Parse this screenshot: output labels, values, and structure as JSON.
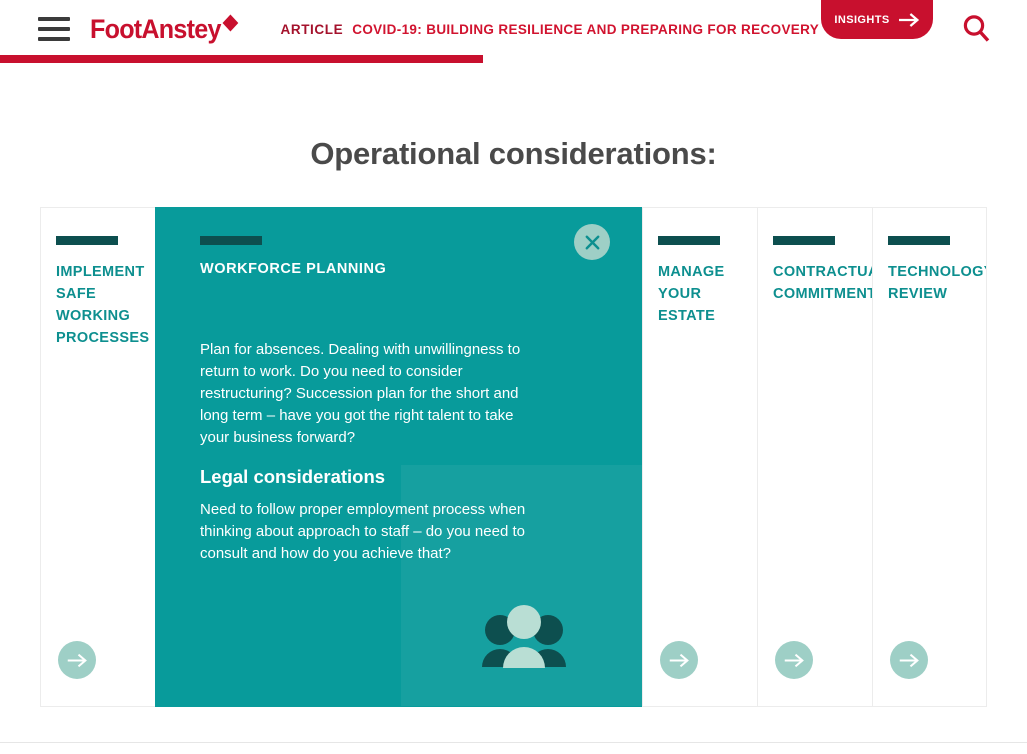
{
  "header": {
    "menu_icon": "hamburger-icon",
    "brand": "FootAnstey",
    "article_kicker": "ARTICLE",
    "article_title": "COVID-19: BUILDING RESILIENCE AND PREPARING FOR RECOVERY",
    "insights_label": "INSIGHTS",
    "insights_icon": "arrow-right-icon",
    "search_icon": "search-icon",
    "brand_color": "#c8102e",
    "progress_percent": 47
  },
  "main": {
    "page_title": "Operational considerations:",
    "accent_color": "#089b9b",
    "rule_color": "#0d4f4f",
    "title_color": "#0d8f8f",
    "arrow_circle_color": "#9ecfc6",
    "cards": [
      {
        "id": "implement-safe-working-processes",
        "title": "IMPLEMENT\nSAFE\nWORKING\nPROCESSES",
        "title_lines": [
          "IMPLEMENT",
          "SAFE",
          "WORKING",
          "PROCESSES"
        ],
        "expanded": false,
        "arrow_icon": "arrow-right-icon"
      },
      {
        "id": "workforce-planning",
        "title": "WORKFORCE PLANNING",
        "expanded": true,
        "close_icon": "close-icon",
        "icon": "people-group-icon",
        "paragraph": "Plan for absences. Dealing with unwillingness to return to work. Do you need to consider restructuring? Succession plan for the short and long term – have you got the right talent to take your business forward?",
        "subheading": "Legal considerations",
        "legal_paragraph": "Need to follow proper employment process when thinking about approach to staff – do you need to consult and how do you achieve that?"
      },
      {
        "id": "manage-your-estate",
        "title": "MANAGE\nYOUR\nESTATE",
        "title_lines": [
          "MANAGE",
          "YOUR",
          "ESTATE"
        ],
        "expanded": false,
        "arrow_icon": "arrow-right-icon"
      },
      {
        "id": "contractual-commitments",
        "title": "CONTRACTUAL\nCOMMITMENTS",
        "title_lines": [
          "CONTRACTUAL",
          "COMMITMENTS"
        ],
        "expanded": false,
        "arrow_icon": "arrow-right-icon"
      },
      {
        "id": "technology-review",
        "title": "TECHNOLOGY\nREVIEW",
        "title_lines": [
          "TECHNOLOGY",
          "REVIEW"
        ],
        "expanded": false,
        "arrow_icon": "arrow-right-icon"
      }
    ]
  }
}
